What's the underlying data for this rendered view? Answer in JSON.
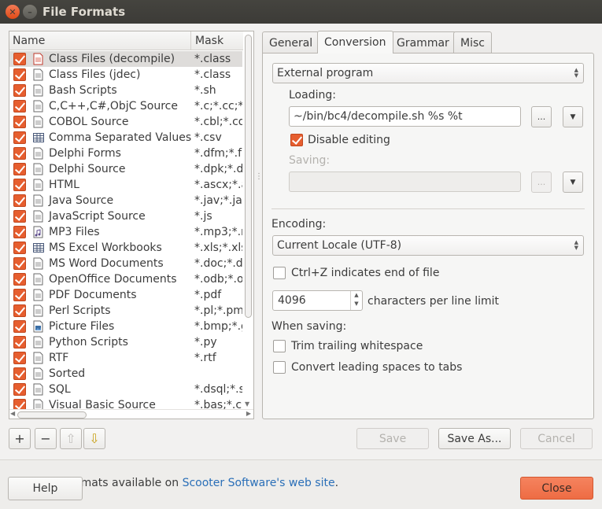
{
  "window": {
    "title": "File Formats"
  },
  "list": {
    "col_name": "Name",
    "col_mask": "Mask",
    "rows": [
      {
        "name": "Class Files (decompile)",
        "mask": "*.class",
        "icon": "document-red-icon"
      },
      {
        "name": "Class Files (jdec)",
        "mask": "*.class",
        "icon": "document-icon"
      },
      {
        "name": "Bash Scripts",
        "mask": "*.sh",
        "icon": "document-icon"
      },
      {
        "name": "C,C++,C#,ObjC Source",
        "mask": "*.c;*.cc;*.",
        "icon": "document-icon"
      },
      {
        "name": "COBOL Source",
        "mask": "*.cbl;*.co",
        "icon": "document-icon"
      },
      {
        "name": "Comma Separated Values",
        "mask": "*.csv",
        "icon": "table-icon"
      },
      {
        "name": "Delphi Forms",
        "mask": "*.dfm;*.fr",
        "icon": "document-icon"
      },
      {
        "name": "Delphi Source",
        "mask": "*.dpk;*.dp",
        "icon": "document-icon"
      },
      {
        "name": "HTML",
        "mask": "*.ascx;*.a",
        "icon": "document-icon"
      },
      {
        "name": "Java Source",
        "mask": "*.jav;*.jav",
        "icon": "document-icon"
      },
      {
        "name": "JavaScript Source",
        "mask": "*.js",
        "icon": "document-icon"
      },
      {
        "name": "MP3 Files",
        "mask": "*.mp3;*.m",
        "icon": "music-file-icon"
      },
      {
        "name": "MS Excel Workbooks",
        "mask": "*.xls;*.xls",
        "icon": "table-icon"
      },
      {
        "name": "MS Word Documents",
        "mask": "*.doc;*.do",
        "icon": "document-icon"
      },
      {
        "name": "OpenOffice Documents",
        "mask": "*.odb;*.o",
        "icon": "document-icon"
      },
      {
        "name": "PDF Documents",
        "mask": "*.pdf",
        "icon": "document-icon"
      },
      {
        "name": "Perl Scripts",
        "mask": "*.pl;*.pm",
        "icon": "document-icon"
      },
      {
        "name": "Picture Files",
        "mask": "*.bmp;*.g",
        "icon": "picture-file-icon"
      },
      {
        "name": "Python Scripts",
        "mask": "*.py",
        "icon": "document-icon"
      },
      {
        "name": "RTF",
        "mask": "*.rtf",
        "icon": "document-icon"
      },
      {
        "name": "Sorted",
        "mask": "",
        "icon": "document-icon"
      },
      {
        "name": "SQL",
        "mask": "*.dsql;*.s",
        "icon": "document-icon"
      },
      {
        "name": "Visual Basic Source",
        "mask": "*.bas;*.cl",
        "icon": "document-icon"
      }
    ]
  },
  "list_buttons": {
    "add": "+",
    "remove": "−",
    "up": "⇧",
    "down": "⇩"
  },
  "tabs": [
    {
      "label": "General"
    },
    {
      "label": "Conversion"
    },
    {
      "label": "Grammar"
    },
    {
      "label": "Misc"
    }
  ],
  "conversion": {
    "type_select": "External program",
    "loading_label": "Loading:",
    "loading_value": "~/bin/bc4/decompile.sh %s %t",
    "browse_label": "...",
    "disable_editing_label": "Disable editing",
    "saving_label": "Saving:",
    "saving_value": "",
    "encoding_label": "Encoding:",
    "encoding_value": "Current Locale (UTF-8)",
    "ctrlz_label": "Ctrl+Z indicates end of file",
    "line_limit_value": "4096",
    "line_limit_label": "characters per line limit",
    "when_saving_label": "When saving:",
    "trim_label": "Trim trailing whitespace",
    "convert_label": "Convert leading spaces to tabs"
  },
  "actions": {
    "save": "Save",
    "save_as": "Save As...",
    "cancel": "Cancel"
  },
  "footer": {
    "help": "Help",
    "info_prefix": "nal file formats available on ",
    "info_link": "Scooter Software's web site",
    "info_suffix": ".",
    "close": "Close"
  },
  "colors": {
    "accent": "#e65e2f",
    "close_button": "#ee6c44",
    "link": "#2a6fb8",
    "titlebar": "#3c3b37"
  }
}
